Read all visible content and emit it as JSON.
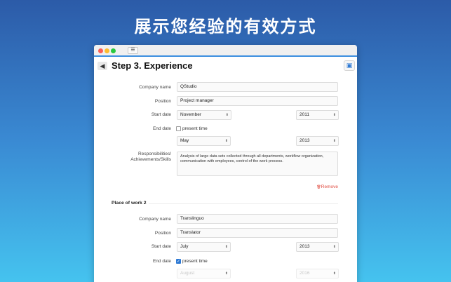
{
  "headline": "展示您经验的有效方式",
  "window": {
    "sidebar_toggle_glyph": "☰",
    "back_glyph": "◀",
    "step_title": "Step 3. Experience",
    "case_glyph": "▣"
  },
  "form1": {
    "company_label": "Company name",
    "company_value": "QStudio",
    "position_label": "Position",
    "position_value": "Project manager",
    "start_label": "Start date",
    "start_month": "November",
    "start_year": "2011",
    "end_label": "End date",
    "present_label": "present time",
    "present_checked": false,
    "end_month": "May",
    "end_year": "2013",
    "resp_label_1": "Responsibilities/",
    "resp_label_2": "Achievements/Skills",
    "resp_value": "Analysis of large data sets collected through all departments, workflow organization, communication with employees, control of the work process.",
    "remove_label": "Remove",
    "remove_glyph": "🗑"
  },
  "form2": {
    "section_title": "Place of work 2",
    "company_label": "Company name",
    "company_value": "Translinguo",
    "position_label": "Position",
    "position_value": "Translator",
    "start_label": "Start date",
    "start_month": "July",
    "start_year": "2013",
    "end_label": "End date",
    "present_label": "present time",
    "present_checked": true,
    "check_glyph": "✓",
    "end_month": "August",
    "end_year": "2016"
  },
  "arrow_glyph": "⬍",
  "colors": {
    "accent": "#2f7ad4",
    "remove": "#e04a3f",
    "bg_top": "#2c5ba8",
    "bg_bottom": "#45c3ef"
  }
}
